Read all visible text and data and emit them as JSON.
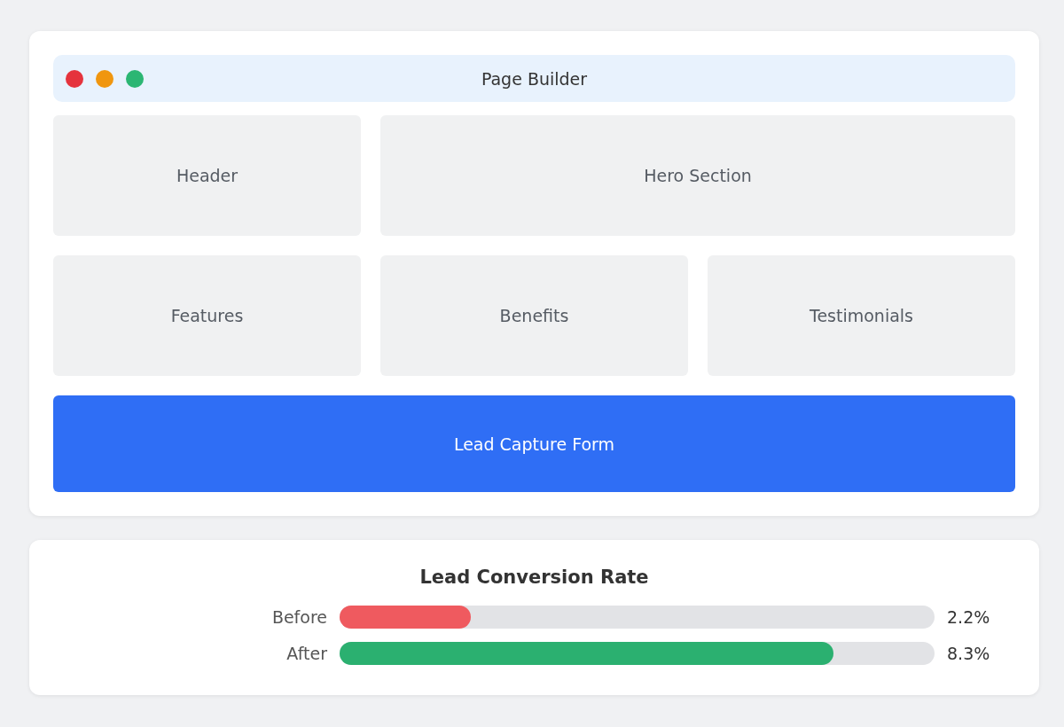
{
  "window": {
    "title": "Page Builder"
  },
  "layout_rows": [
    {
      "blocks": [
        {
          "label": "Header",
          "highlighted": false
        },
        {
          "label": "Hero Section",
          "highlighted": false
        }
      ]
    },
    {
      "blocks": [
        {
          "label": "Features",
          "highlighted": false
        },
        {
          "label": "Benefits",
          "highlighted": false
        },
        {
          "label": "Testimonials",
          "highlighted": false
        }
      ]
    },
    {
      "blocks": [
        {
          "label": "Lead Capture Form",
          "highlighted": true
        }
      ]
    }
  ],
  "conversion": {
    "title": "Lead Conversion Rate",
    "bars": [
      {
        "label": "Before",
        "level": 0.22,
        "color": "#ef5a5f",
        "reading": "2.2%"
      },
      {
        "label": "After",
        "level": 0.83,
        "color": "#2bb070",
        "reading": "8.3%"
      }
    ]
  }
}
